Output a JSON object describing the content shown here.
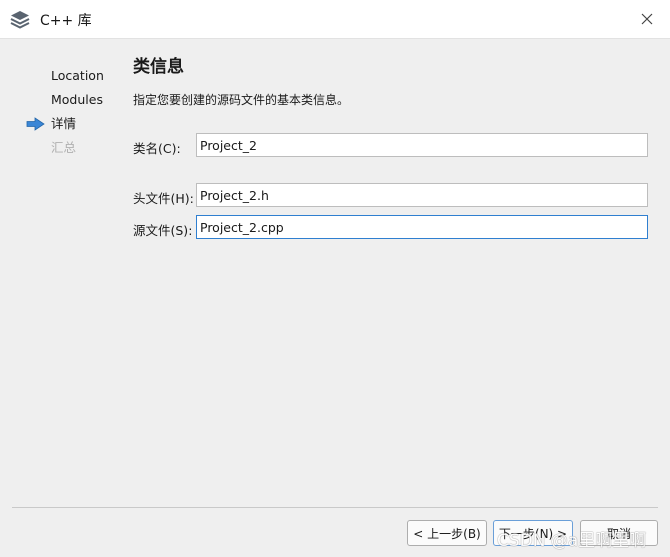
{
  "window": {
    "title": "C++ 库"
  },
  "steps": [
    {
      "label": "Location",
      "state": "done"
    },
    {
      "label": "Modules",
      "state": "done"
    },
    {
      "label": "详情",
      "state": "current"
    },
    {
      "label": "汇总",
      "state": "pending"
    }
  ],
  "page": {
    "title": "类信息",
    "description": "指定您要创建的源码文件的基本类信息。"
  },
  "fields": {
    "class_name": {
      "label": "类名(C):",
      "value": "Project_2"
    },
    "header_file": {
      "label": "头文件(H):",
      "value": "Project_2.h"
    },
    "source_file": {
      "label": "源文件(S):",
      "value": "Project_2.cpp"
    }
  },
  "buttons": {
    "back": "< 上一步(B)",
    "next": "下一步(N) >",
    "cancel": "取消"
  },
  "watermark": "CSDN @a里啊里啊",
  "colors": {
    "arrow": "#3a86d6",
    "focus_border": "#2f7fd0",
    "background": "#efefef"
  }
}
